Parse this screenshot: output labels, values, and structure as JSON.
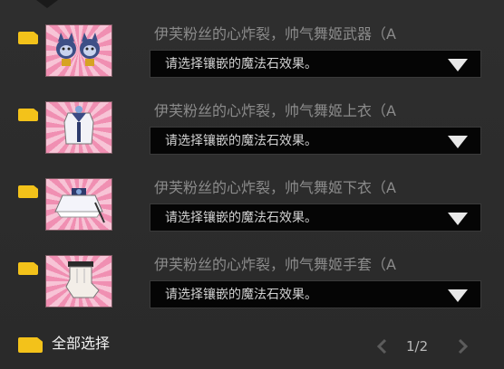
{
  "items": [
    {
      "name": "伊芙粉丝的心炸裂，帅气舞姬武器（A",
      "select_value": "请选择镶嵌的魔法石效果。",
      "icon": "cat-gloves-weapon-icon"
    },
    {
      "name": "伊芙粉丝的心炸裂，帅气舞姬上衣（A",
      "select_value": "请选择镶嵌的魔法石效果。",
      "icon": "dancer-top-icon"
    },
    {
      "name": "伊芙粉丝的心炸裂，帅气舞姬下衣（A",
      "select_value": "请选择镶嵌的魔法石效果。",
      "icon": "dancer-skirt-icon"
    },
    {
      "name": "伊芙粉丝的心炸裂，帅气舞姬手套（A",
      "select_value": "请选择镶嵌的魔法石效果。",
      "icon": "dancer-glove-icon"
    }
  ],
  "footer": {
    "select_all_label": "全部选择",
    "page_indicator": "1/2"
  },
  "colors": {
    "checkbox": "#f3c21a",
    "item_name": "#8b8b8b",
    "select_bg": "#050505",
    "panel_bg": "#2b2b2b"
  }
}
